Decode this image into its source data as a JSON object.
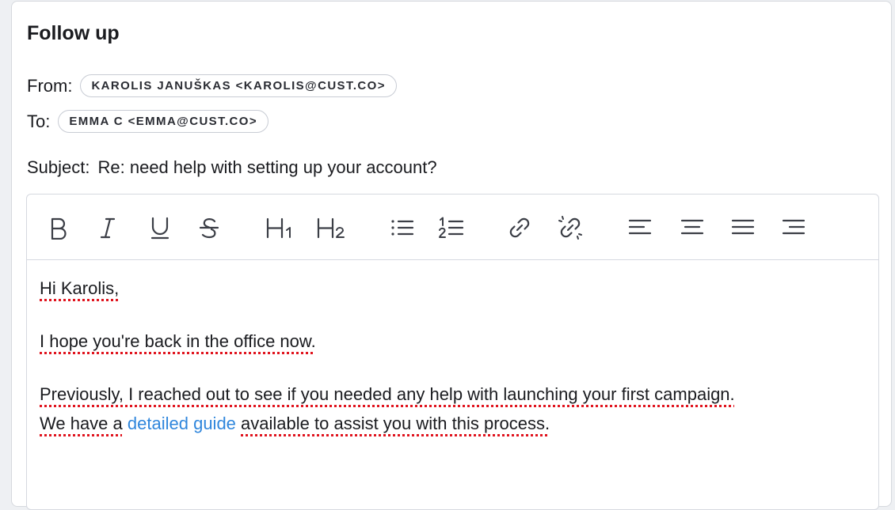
{
  "title": "Follow up",
  "from": {
    "label": "From:",
    "value": "KAROLIS JANUŠKAS <KAROLIS@CUST.CO>"
  },
  "to": {
    "label": "To:",
    "value": "EMMA C <EMMA@CUST.CO>"
  },
  "subject": {
    "label": "Subject:",
    "value": "Re: need help with setting up your account?"
  },
  "toolbar": {
    "icons": [
      "bold-icon",
      "italic-icon",
      "underline-icon",
      "strikethrough-icon",
      "heading-1-icon",
      "heading-2-icon",
      "bullet-list-icon",
      "numbered-list-icon",
      "link-icon",
      "unlink-icon",
      "align-left-icon",
      "align-center-icon",
      "align-justify-icon",
      "align-right-icon"
    ],
    "h1_label": "H",
    "h1_sub": "1",
    "h2_label": "H",
    "h2_sub": "2"
  },
  "body": {
    "greeting": "Hi Karolis,",
    "line1": "I hope you're back in the office now.",
    "line2": "Previously, I reached out to see if you needed any help with launching your first campaign.",
    "line3_before": "We have a",
    "line3_link": "detailed guide",
    "line3_after": "available to assist you with this process."
  },
  "colors": {
    "link": "#2f86dc",
    "spellcheck": "#e0141e",
    "chip_border": "#c8ccd4"
  }
}
